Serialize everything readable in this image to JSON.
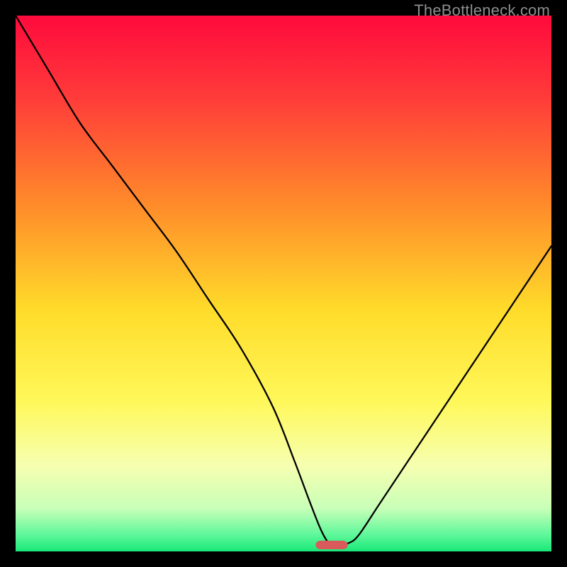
{
  "watermark": "TheBottleneck.com",
  "chart_data": {
    "type": "line",
    "title": "",
    "xlabel": "",
    "ylabel": "",
    "xlim": [
      0,
      100
    ],
    "ylim": [
      0,
      100
    ],
    "grid": false,
    "legend": false,
    "background_gradient": {
      "stops": [
        {
          "offset": 0,
          "color": "#ff0a3c"
        },
        {
          "offset": 15,
          "color": "#ff3a3a"
        },
        {
          "offset": 35,
          "color": "#ff8a2a"
        },
        {
          "offset": 55,
          "color": "#ffdc2a"
        },
        {
          "offset": 72,
          "color": "#fff85a"
        },
        {
          "offset": 84,
          "color": "#f6ffb0"
        },
        {
          "offset": 92,
          "color": "#c8ffb8"
        },
        {
          "offset": 97,
          "color": "#5cf79a"
        },
        {
          "offset": 100,
          "color": "#18e877"
        }
      ]
    },
    "series": [
      {
        "name": "bottleneck-curve",
        "color": "#000000",
        "x": [
          0,
          6,
          12,
          18,
          24,
          30,
          36,
          42,
          48,
          52,
          55,
          57,
          58.5,
          60,
          62,
          64,
          68,
          74,
          82,
          90,
          100
        ],
        "y": [
          100,
          90,
          80,
          72,
          64,
          56,
          47,
          38,
          27,
          17,
          9,
          4,
          1.5,
          1.2,
          1.5,
          3,
          9,
          18,
          30,
          42,
          57
        ]
      }
    ],
    "marker": {
      "name": "optimum-marker",
      "x": 59,
      "y": 1.2,
      "width": 6,
      "height": 1.6,
      "color": "#d85a5a",
      "radius": 0.9
    }
  }
}
